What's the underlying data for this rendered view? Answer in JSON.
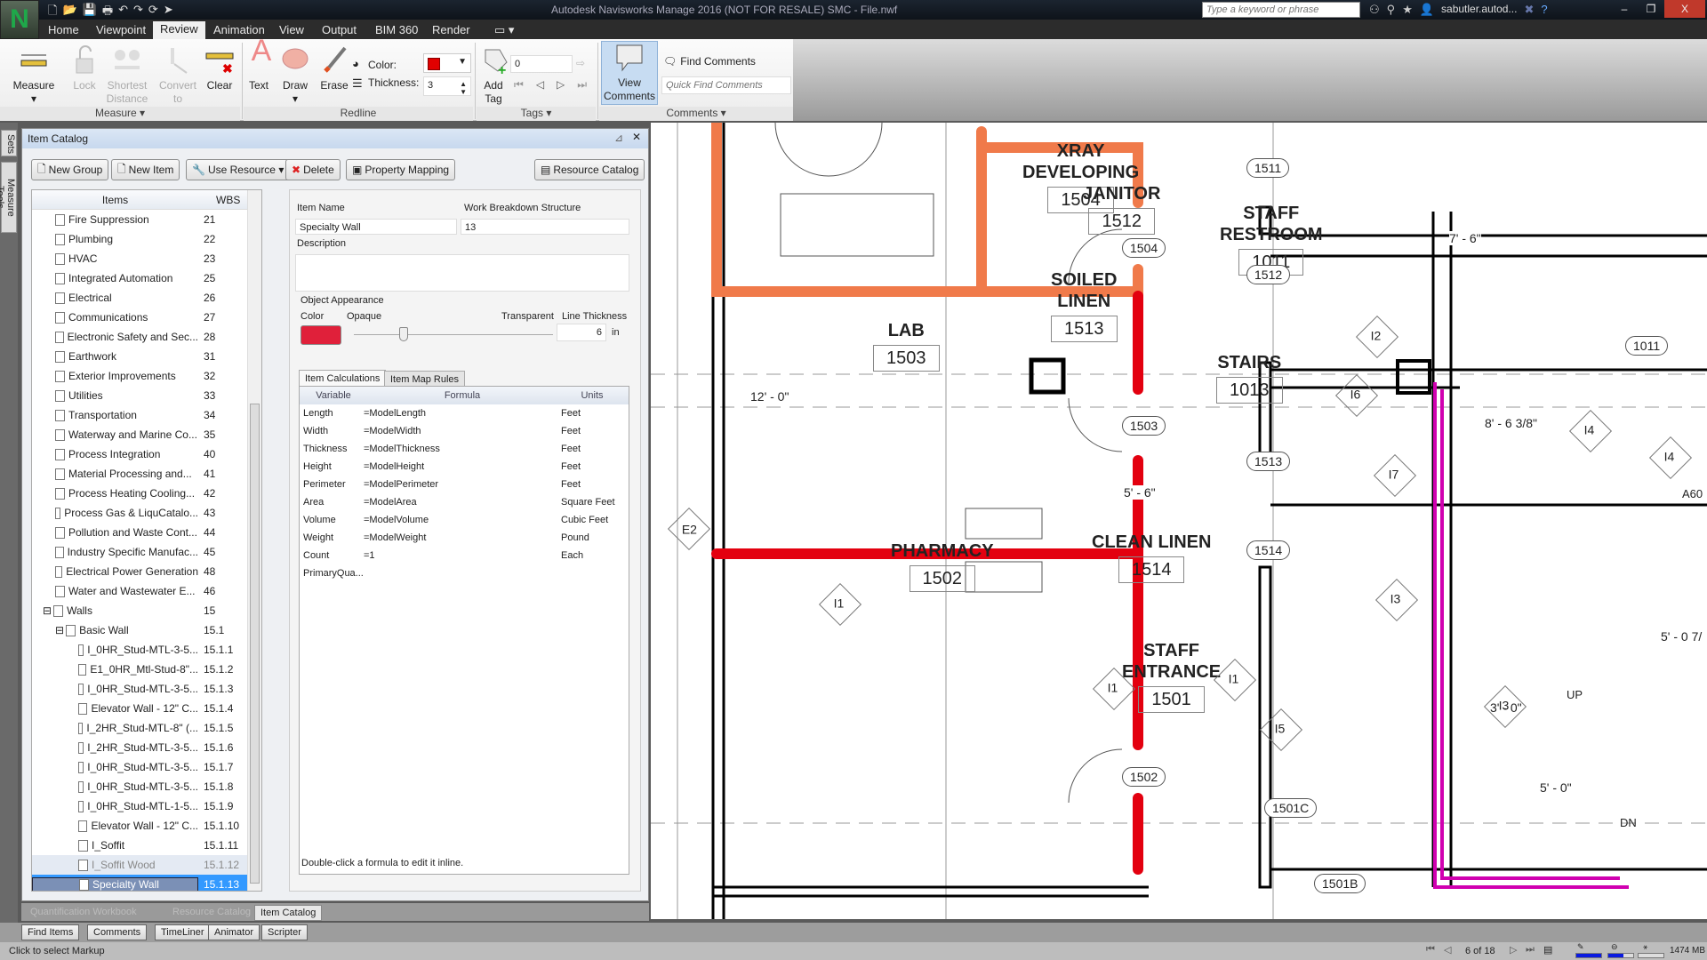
{
  "window": {
    "title": "Autodesk Navisworks Manage 2016 (NOT FOR RESALE)   SMC - File.nwf",
    "search_placeholder": "Type a keyword or phrase",
    "user": "sabutler.autod...",
    "minimize": "–",
    "restore": "❐",
    "close": "X"
  },
  "quick_access": [
    "new-icon",
    "open-icon",
    "save-icon",
    "print-icon",
    "undo-icon",
    "redo-icon",
    "refresh-icon",
    "select-icon"
  ],
  "menu_tabs": [
    "Home",
    "Viewpoint",
    "Review",
    "Animation",
    "View",
    "Output",
    "BIM 360",
    "Render"
  ],
  "active_tab": "Review",
  "ribbon": {
    "measure": {
      "label": "Measure",
      "lock": "Lock",
      "shortest": "Shortest Distance",
      "convert": "Convert to Redline",
      "clear": "Clear",
      "group": "Measure"
    },
    "redline": {
      "text": "Text",
      "draw": "Draw",
      "erase": "Erase",
      "color_label": "Color:",
      "thickness_label": "Thickness:",
      "thickness_value": "3",
      "color_value": "#e00000",
      "group": "Redline"
    },
    "tags": {
      "add_tag": "Add Tag",
      "tag_value": "0",
      "group": "Tags"
    },
    "comments": {
      "view": "View Comments",
      "find": "Find Comments",
      "quick_find_placeholder": "Quick Find Comments",
      "group": "Comments"
    }
  },
  "side_tabs": [
    "Sets",
    "Measure Tools"
  ],
  "panel": {
    "title": "Item Catalog",
    "buttons": [
      "New Group",
      "New Item",
      "Use Resource ▾",
      "Delete",
      "Property Mapping",
      "Resource Catalog"
    ],
    "tree_headers": {
      "items": "Items",
      "wbs": "WBS"
    },
    "tree": [
      {
        "name": "Fire Suppression",
        "wbs": "21",
        "level": 1
      },
      {
        "name": "Plumbing",
        "wbs": "22",
        "level": 1
      },
      {
        "name": "HVAC",
        "wbs": "23",
        "level": 1
      },
      {
        "name": "Integrated Automation",
        "wbs": "25",
        "level": 1
      },
      {
        "name": "Electrical",
        "wbs": "26",
        "level": 1
      },
      {
        "name": "Communications",
        "wbs": "27",
        "level": 1
      },
      {
        "name": "Electronic Safety and Sec...",
        "wbs": "28",
        "level": 1
      },
      {
        "name": "Earthwork",
        "wbs": "31",
        "level": 1
      },
      {
        "name": "Exterior Improvements",
        "wbs": "32",
        "level": 1
      },
      {
        "name": "Utilities",
        "wbs": "33",
        "level": 1
      },
      {
        "name": "Transportation",
        "wbs": "34",
        "level": 1
      },
      {
        "name": "Waterway and Marine Co...",
        "wbs": "35",
        "level": 1
      },
      {
        "name": "Process Integration",
        "wbs": "40",
        "level": 1
      },
      {
        "name": "Material Processing and...",
        "wbs": "41",
        "level": 1
      },
      {
        "name": "Process Heating Cooling...",
        "wbs": "42",
        "level": 1
      },
      {
        "name": "Process Gas & LiquCatalo...",
        "wbs": "43",
        "level": 1
      },
      {
        "name": "Pollution and Waste Cont...",
        "wbs": "44",
        "level": 1
      },
      {
        "name": "Industry Specific Manufac...",
        "wbs": "45",
        "level": 1
      },
      {
        "name": "Electrical Power Generation",
        "wbs": "48",
        "level": 1
      },
      {
        "name": "Water and Wastewater E...",
        "wbs": "46",
        "level": 1
      },
      {
        "name": "Walls",
        "wbs": "15",
        "level": 1,
        "expanded": true
      },
      {
        "name": "Basic Wall",
        "wbs": "15.1",
        "level": 2,
        "expanded": true
      },
      {
        "name": "I_0HR_Stud-MTL-3-5...",
        "wbs": "15.1.1",
        "level": 3
      },
      {
        "name": "E1_0HR_Mtl-Stud-8\"...",
        "wbs": "15.1.2",
        "level": 3
      },
      {
        "name": "I_0HR_Stud-MTL-3-5...",
        "wbs": "15.1.3",
        "level": 3
      },
      {
        "name": "Elevator Wall - 12\" C...",
        "wbs": "15.1.4",
        "level": 3
      },
      {
        "name": "I_2HR_Stud-MTL-8\" (...",
        "wbs": "15.1.5",
        "level": 3
      },
      {
        "name": "I_2HR_Stud-MTL-3-5...",
        "wbs": "15.1.6",
        "level": 3
      },
      {
        "name": "I_0HR_Stud-MTL-3-5...",
        "wbs": "15.1.7",
        "level": 3
      },
      {
        "name": "I_0HR_Stud-MTL-3-5...",
        "wbs": "15.1.8",
        "level": 3
      },
      {
        "name": "I_0HR_Stud-MTL-1-5...",
        "wbs": "15.1.9",
        "level": 3
      },
      {
        "name": "Elevator Wall - 12\" C...",
        "wbs": "15.1.10",
        "level": 3
      },
      {
        "name": "I_Soffit",
        "wbs": "15.1.11",
        "level": 3
      },
      {
        "name": "I_Soffit Wood",
        "wbs": "15.1.12",
        "level": 3,
        "hover": true
      },
      {
        "name": "Specialty Wall",
        "wbs": "15.1.13",
        "level": 3,
        "selected": true
      }
    ],
    "detail": {
      "item_name_label": "Item Name",
      "item_name": "Specialty Wall",
      "wbs_label": "Work Breakdown Structure",
      "wbs": "13",
      "description_label": "Description",
      "description": "",
      "appearance_label": "Object Appearance",
      "color_label": "Color",
      "color": "#e0203a",
      "opaque_label": "Opaque",
      "transparent_label": "Transparent",
      "transparency_percent": 25,
      "line_thickness_label": "Line Thickness",
      "line_thickness": "6",
      "line_unit": "in",
      "tabs": [
        "Item Calculations",
        "Item Map Rules"
      ],
      "calc_headers": {
        "variable": "Variable",
        "formula": "Formula",
        "units": "Units"
      },
      "calcs": [
        {
          "v": "Length",
          "f": "=ModelLength",
          "u": "Feet"
        },
        {
          "v": "Width",
          "f": "=ModelWidth",
          "u": "Feet"
        },
        {
          "v": "Thickness",
          "f": "=ModelThickness",
          "u": "Feet"
        },
        {
          "v": "Height",
          "f": "=ModelHeight",
          "u": "Feet"
        },
        {
          "v": "Perimeter",
          "f": "=ModelPerimeter",
          "u": "Feet"
        },
        {
          "v": "Area",
          "f": "=ModelArea",
          "u": "Square Feet"
        },
        {
          "v": "Volume",
          "f": "=ModelVolume",
          "u": "Cubic Feet"
        },
        {
          "v": "Weight",
          "f": "=ModelWeight",
          "u": "Pound"
        },
        {
          "v": "Count",
          "f": "=1",
          "u": "Each"
        },
        {
          "v": "PrimaryQua...",
          "f": "",
          "u": ""
        }
      ],
      "hint": "Double-click a formula to edit it inline."
    }
  },
  "bottom_tabs": [
    "Quantification Workbook",
    "Resource Catalog",
    "Item Catalog"
  ],
  "tool_tabs": [
    "Find Items",
    "Comments",
    "TimeLiner",
    "Animator",
    "Scripter"
  ],
  "status": {
    "text": "Click to select Markup",
    "page": "6 of 18",
    "memory": "1474 MB",
    "progress": [
      1.0,
      0.6,
      0.0
    ]
  },
  "plan": {
    "rooms": [
      {
        "name": "XRAY\nDEVELOPING",
        "num": "1504"
      },
      {
        "name": "LAB",
        "num": "1503"
      },
      {
        "name": "PHARMACY",
        "num": "1502"
      },
      {
        "name": "JANITOR",
        "num": "1512"
      },
      {
        "name": "SOILED\nLINEN",
        "num": "1513"
      },
      {
        "name": "STAFF\nRESTROOM",
        "num": "1011"
      },
      {
        "name": "STAIRS",
        "num": "1013"
      },
      {
        "name": "CLEAN LINEN",
        "num": "1514"
      },
      {
        "name": "STAFF\nENTRANCE",
        "num": "1501"
      }
    ],
    "door_tags": [
      "1504",
      "1503",
      "1502",
      "1511",
      "1512",
      "1513",
      "1514",
      "1011",
      "1501B",
      "1501C"
    ],
    "type_tags": [
      "E2",
      "I1",
      "I1",
      "I1",
      "I2",
      "I3",
      "I3",
      "I4",
      "I4",
      "I5",
      "I6",
      "I7"
    ],
    "dims": [
      "12' - 0\"",
      "5' - 6\"",
      "7' - 6\"",
      "8' - 6 3/8\"",
      "3' - 0\"",
      "5' - 0\"",
      "5' - 0 7/"
    ],
    "misc": [
      "UP",
      "DN",
      "A60"
    ],
    "colors": {
      "orange": "#f07a4a",
      "red": "#e3000f",
      "magenta": "#d000b0"
    }
  }
}
